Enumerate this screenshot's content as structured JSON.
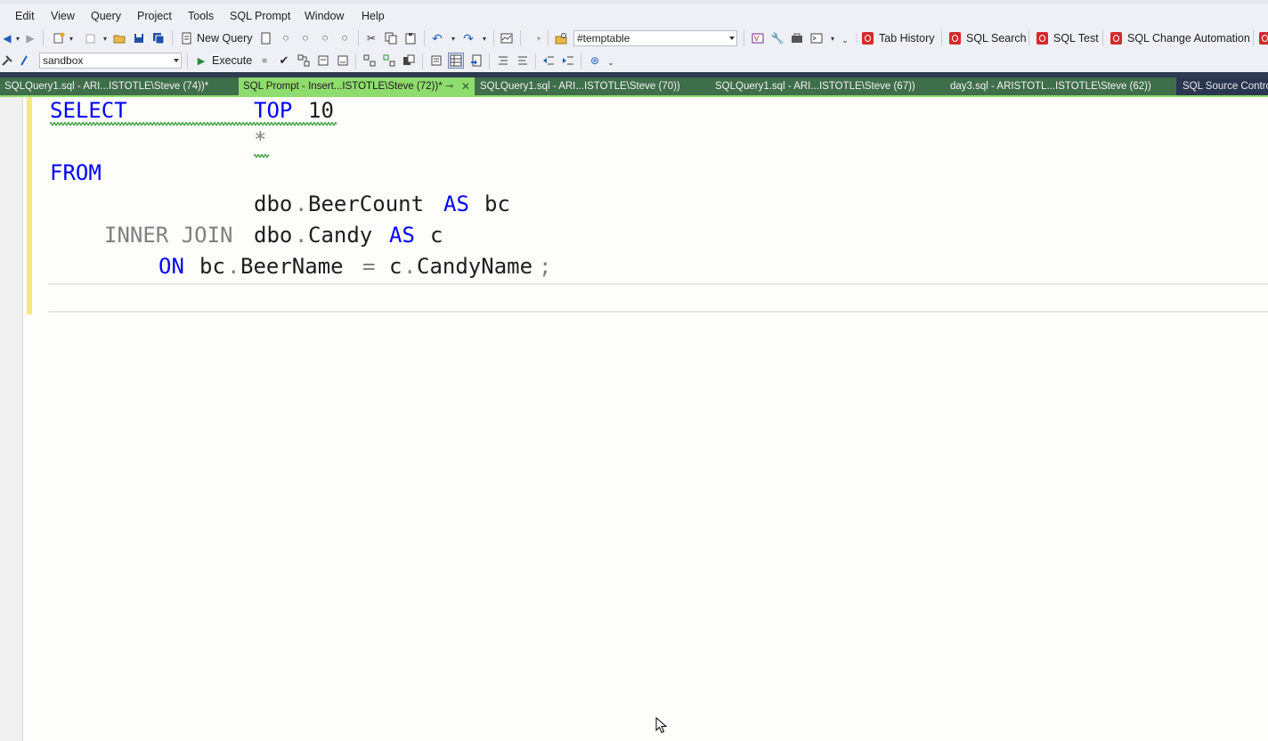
{
  "menu": [
    "Edit",
    "View",
    "Query",
    "Project",
    "Tools",
    "SQL Prompt",
    "Window",
    "Help"
  ],
  "toolbar1": {
    "new_query": "New Query",
    "temp_combo": "#temptable",
    "tab_history": "Tab History",
    "sql_search": "SQL Search",
    "sql_test": "SQL Test",
    "sql_change_automation": "SQL Change Automation"
  },
  "toolbar2": {
    "database": "sandbox",
    "execute": "Execute"
  },
  "tabs": [
    {
      "label": "SQLQuery1.sql - ARI...ISTOTLE\\Steve (74))*",
      "active": false
    },
    {
      "label": "SQL Prompt - Insert...ISTOTLE\\Steve (72))*",
      "active": true
    },
    {
      "label": "SQLQuery1.sql - ARI...ISTOTLE\\Steve (70))",
      "active": false
    },
    {
      "label": "SQLQuery1.sql - ARI...ISTOTLE\\Steve (67))",
      "active": false
    },
    {
      "label": "day3.sql - ARISTOTL...ISTOTLE\\Steve (62))",
      "active": false
    },
    {
      "label": "SQL Source Control",
      "active": false
    }
  ],
  "editor": {
    "line1_kw1": "SELECT",
    "line1_kw2": "TOP",
    "line1_num": "10",
    "line2_star": "*",
    "line3_kw": "FROM",
    "line4_obj": "dbo",
    "line4_dot": ".",
    "line4_tbl": "BeerCount",
    "line4_as": "AS",
    "line4_alias": "bc",
    "line5_join": "INNER JOIN",
    "line5_obj": "dbo",
    "line5_dot": ".",
    "line5_tbl": "Candy",
    "line5_as": "AS",
    "line5_alias": "c",
    "line6_on": "ON",
    "line6_a": "bc",
    "line6_dot1": ".",
    "line6_col1": "BeerName",
    "line6_eq": "=",
    "line6_b": "c",
    "line6_dot2": ".",
    "line6_col2": "CandyName",
    "line6_semi": ";"
  },
  "colors": {
    "keyword": "#0000ff",
    "operator": "#808080",
    "active_tab": "#8fdc6e",
    "tab_bar": "#3f6e4a",
    "squiggle": "#3aa03a"
  }
}
